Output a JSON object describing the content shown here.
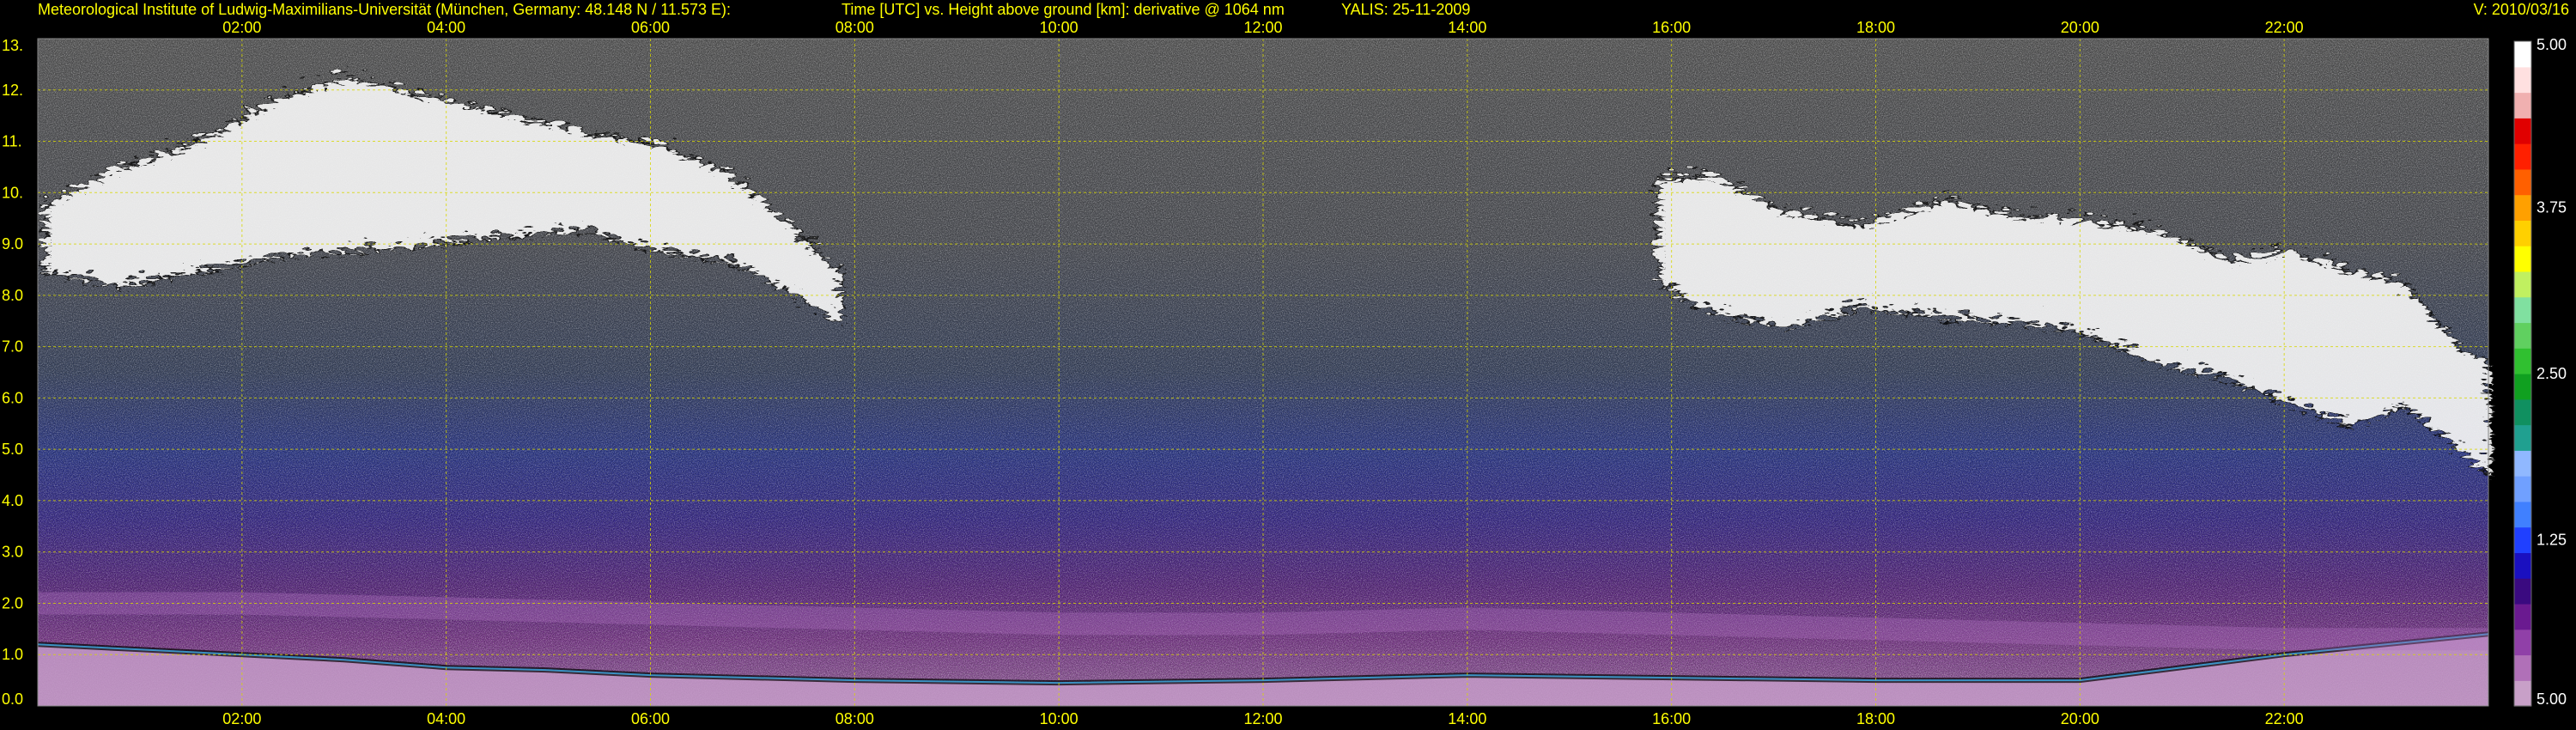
{
  "chart_data": {
    "type": "heatmap",
    "header": {
      "institute": "Meteorological Institute of Ludwig-Maximilians-Universität (München, Germany: 48.148 N / 11.573 E):",
      "title": "Time [UTC] vs. Height above ground [km]: derivative @ 1064 nm",
      "site_date": "YALIS: 25-11-2009",
      "version": "V: 2010/03/16"
    },
    "x_axis": {
      "unit": "hour UTC",
      "range": [
        0,
        24
      ],
      "ticks": [
        {
          "value": 2,
          "label": "02:00"
        },
        {
          "value": 4,
          "label": "04:00"
        },
        {
          "value": 6,
          "label": "06:00"
        },
        {
          "value": 8,
          "label": "08:00"
        },
        {
          "value": 10,
          "label": "10:00"
        },
        {
          "value": 12,
          "label": "12:00"
        },
        {
          "value": 14,
          "label": "14:00"
        },
        {
          "value": 16,
          "label": "16:00"
        },
        {
          "value": 18,
          "label": "18:00"
        },
        {
          "value": 20,
          "label": "20:00"
        },
        {
          "value": 22,
          "label": "22:00"
        }
      ]
    },
    "y_axis": {
      "unit": "km",
      "range": [
        0,
        13
      ],
      "ticks": [
        {
          "value": 0,
          "label": "0.0"
        },
        {
          "value": 1,
          "label": "1.0"
        },
        {
          "value": 2,
          "label": "2.0"
        },
        {
          "value": 3,
          "label": "3.0"
        },
        {
          "value": 4,
          "label": "4.0"
        },
        {
          "value": 5,
          "label": "5.0"
        },
        {
          "value": 6,
          "label": "6.0"
        },
        {
          "value": 7,
          "label": "7.0"
        },
        {
          "value": 8,
          "label": "8.0"
        },
        {
          "value": 9,
          "label": "9.0"
        },
        {
          "value": 10,
          "label": "10."
        },
        {
          "value": 11,
          "label": "11."
        },
        {
          "value": 12,
          "label": "12."
        },
        {
          "value": 13,
          "label": "13."
        }
      ]
    },
    "grid": true,
    "colorbar": {
      "position": "right",
      "labels": [
        {
          "value": 5.0,
          "label": "5.00"
        },
        {
          "value": 3.75,
          "label": "3.75"
        },
        {
          "value": 2.5,
          "label": "2.50"
        },
        {
          "value": 1.25,
          "label": "1.25"
        },
        {
          "value": 0.0,
          "label": "5.00"
        }
      ],
      "colors": [
        "#c8a0c8",
        "#b070b8",
        "#9040a8",
        "#6a1a90",
        "#3a0a80",
        "#1a10c0",
        "#2040ff",
        "#4080ff",
        "#70a0ff",
        "#90b8ff",
        "#20a090",
        "#109060",
        "#10a020",
        "#30c030",
        "#60d060",
        "#80e0a0",
        "#c0f060",
        "#ffff00",
        "#ffd000",
        "#ffa000",
        "#ff6000",
        "#ff2000",
        "#e00000",
        "#f0b0b0",
        "#ffe0e0",
        "#ffffff"
      ]
    },
    "features": [
      {
        "name": "cirrus_night",
        "x": [
          0.0,
          0.7,
          1.5,
          2.3,
          3.0,
          3.7,
          4.5,
          5.3,
          6.0,
          6.7,
          7.3,
          7.8,
          7.3,
          6.6,
          5.8,
          5.0,
          4.2,
          3.4,
          2.6,
          1.8,
          1.0,
          0.3,
          0.0
        ],
        "y_top": [
          9.9,
          10.6,
          11.1,
          12.0,
          12.4,
          12.0,
          11.7,
          11.3,
          11.1,
          10.5,
          9.5,
          8.6
        ],
        "y_bottom": [
          8.6,
          8.3,
          8.6,
          8.9,
          9.0,
          9.1,
          9.3,
          9.4,
          9.0,
          8.8,
          8.2,
          7.6
        ]
      },
      {
        "name": "cirrus_evening",
        "x": [
          15.8,
          16.3,
          17.0,
          17.8,
          18.6,
          19.3,
          20.0,
          20.7,
          21.4,
          22.0,
          22.6,
          23.1,
          23.6,
          23.95
        ],
        "y_top": [
          10.4,
          10.5,
          9.8,
          9.5,
          10.0,
          9.7,
          9.6,
          9.4,
          8.8,
          9.0,
          8.6,
          8.4,
          7.2,
          6.8
        ],
        "y_bottom": [
          8.4,
          7.8,
          7.5,
          7.9,
          7.7,
          7.6,
          7.4,
          6.8,
          6.5,
          6.0,
          5.6,
          6.0,
          5.2,
          4.6
        ]
      },
      {
        "name": "boundary_layer_aerosol",
        "x": [
          0.0,
          1.0,
          2.0,
          3.0,
          4.0,
          5.0,
          6.0,
          8.0,
          10.0,
          12.0,
          14.0,
          16.0,
          18.0,
          20.0,
          22.0,
          24.0
        ],
        "top": [
          1.2,
          1.1,
          1.0,
          0.9,
          0.75,
          0.7,
          0.6,
          0.5,
          0.45,
          0.5,
          0.6,
          0.55,
          0.5,
          0.5,
          1.0,
          1.4
        ]
      },
      {
        "name": "residual_layer",
        "x": [
          0.0,
          2.0,
          4.0,
          6.0,
          8.0,
          10.0,
          12.0,
          14.0,
          16.0,
          18.0,
          20.0,
          22.0,
          24.0
        ],
        "y": [
          2.0,
          2.0,
          1.9,
          1.8,
          1.7,
          1.6,
          1.6,
          1.7,
          1.6,
          1.5,
          1.4,
          1.3,
          1.3
        ]
      }
    ]
  }
}
